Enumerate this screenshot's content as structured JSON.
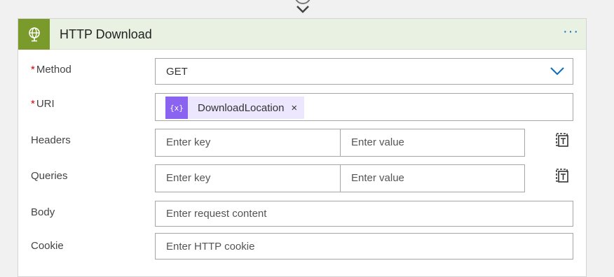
{
  "card": {
    "title": "HTTP Download",
    "header_icon": "globe-icon",
    "more_label": "···",
    "accent_color": "#7a9a2b",
    "header_bg": "#e8f1e2"
  },
  "fields": {
    "method": {
      "required_mark": "*",
      "label": "Method",
      "value": "GET"
    },
    "uri": {
      "required_mark": "*",
      "label": "URI",
      "token_icon": "{x}",
      "token_label": "DownloadLocation",
      "token_remove": "×"
    },
    "headers": {
      "label": "Headers",
      "key_placeholder": "Enter key",
      "value_placeholder": "Enter value"
    },
    "queries": {
      "label": "Queries",
      "key_placeholder": "Enter key",
      "value_placeholder": "Enter value"
    },
    "body": {
      "label": "Body",
      "placeholder": "Enter request content"
    },
    "cookie": {
      "label": "Cookie",
      "placeholder": "Enter HTTP cookie"
    }
  },
  "token_color": "#8a63f0"
}
